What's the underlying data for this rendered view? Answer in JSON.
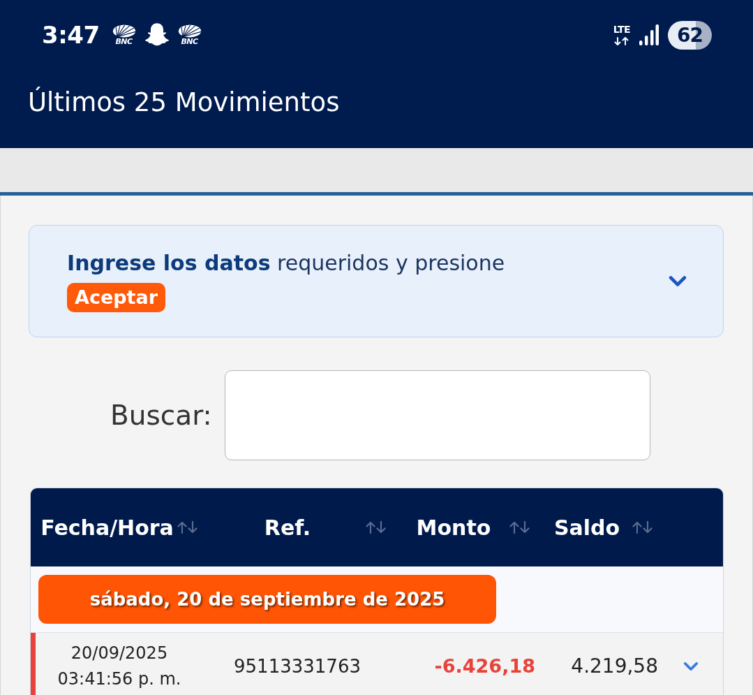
{
  "status_bar": {
    "time": "3:47",
    "notifications": [
      {
        "kind": "logo",
        "label": "BNC"
      },
      {
        "kind": "ghost"
      },
      {
        "kind": "logo",
        "label": "BNC"
      }
    ],
    "network": "LTE",
    "battery": "62"
  },
  "app_bar": {
    "title": "Últimos 25 Movimientos"
  },
  "info_panel": {
    "message": "**Ingrese los datos** requeridos y presione",
    "button": "Aceptar",
    "expanded": false
  },
  "search": {
    "label": "Buscar:"
  },
  "table": {
    "columns": [
      {
        "label": "Fecha/Hora",
        "sortable": true
      },
      {
        "label": "Ref.",
        "sortable": true
      },
      {
        "label": "Monto",
        "sortable": true
      },
      {
        "label": "Saldo",
        "sortable": true
      }
    ],
    "groups": [
      {
        "date": "sábado, 20 de septiembre de 2025",
        "rows": [
          {
            "date": "20/09/2025",
            "time": "03:41:56 p. m.",
            "ref": "95113331763",
            "amount": "-6.426,18",
            "balance": "4.219,58",
            "kind": "debit",
            "expanded": false
          }
        ]
      }
    ]
  }
}
